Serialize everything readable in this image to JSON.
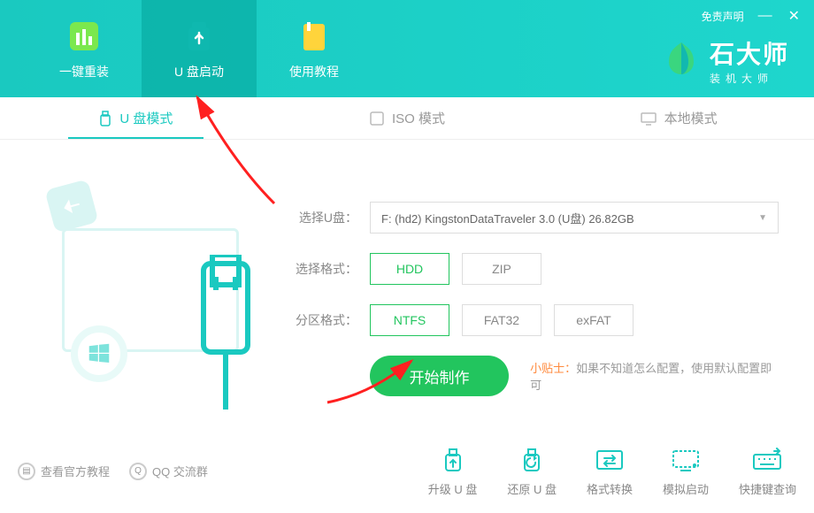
{
  "header": {
    "disclaimer": "免责声明",
    "tabs": [
      {
        "label": "一键重装"
      },
      {
        "label": "U 盘启动"
      },
      {
        "label": "使用教程"
      }
    ]
  },
  "brand": {
    "title": "石大师",
    "subtitle": "装机大师"
  },
  "mode_tabs": [
    {
      "label": "U 盘模式"
    },
    {
      "label": "ISO 模式"
    },
    {
      "label": "本地模式"
    }
  ],
  "form": {
    "select_disk_label": "选择U盘：",
    "select_disk_value": "F: (hd2) KingstonDataTraveler 3.0 (U盘) 26.82GB",
    "format_label": "选择格式：",
    "format_options": [
      "HDD",
      "ZIP"
    ],
    "partition_label": "分区格式：",
    "partition_options": [
      "NTFS",
      "FAT32",
      "exFAT"
    ]
  },
  "actions": {
    "start_label": "开始制作",
    "tip_label": "小贴士：",
    "tip_text": "如果不知道怎么配置，使用默认配置即可"
  },
  "footer": {
    "official_tutorial": "查看官方教程",
    "qq_group": "QQ 交流群",
    "tools": [
      {
        "label": "升级 U 盘"
      },
      {
        "label": "还原 U 盘"
      },
      {
        "label": "格式转换"
      },
      {
        "label": "模拟启动"
      },
      {
        "label": "快捷键查询"
      }
    ]
  }
}
